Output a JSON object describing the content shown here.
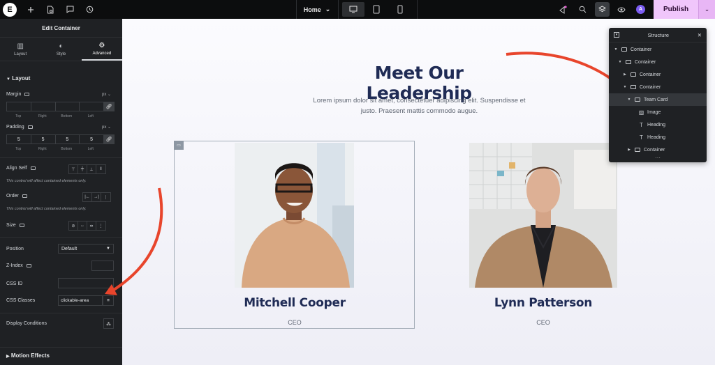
{
  "topbar": {
    "page_name": "Home",
    "publish_label": "Publish",
    "icons": [
      "elementor-logo",
      "add-icon",
      "page-settings-icon",
      "comments-icon",
      "history-icon",
      "desktop-icon",
      "tablet-icon",
      "mobile-icon",
      "notifications-icon",
      "search-icon",
      "structure-icon",
      "preview-icon",
      "account-icon",
      "chevron-down-icon"
    ],
    "account_initial": "A"
  },
  "panel": {
    "title": "Edit Container",
    "tabs": [
      {
        "label": "Layout",
        "icon": "layout-icon"
      },
      {
        "label": "Style",
        "icon": "style-icon"
      },
      {
        "label": "Advanced",
        "icon": "gear-icon",
        "active": true
      }
    ],
    "section_layout": "Layout",
    "margin": {
      "label": "Margin",
      "unit": "px",
      "values": [
        "",
        "",
        "",
        ""
      ],
      "sides": [
        "Top",
        "Right",
        "Bottom",
        "Left"
      ]
    },
    "padding": {
      "label": "Padding",
      "unit": "px",
      "values": [
        "5",
        "5",
        "5",
        "5"
      ],
      "sides": [
        "Top",
        "Right",
        "Bottom",
        "Left"
      ]
    },
    "align_self": {
      "label": "Align Self",
      "note": "This control will affect contained elements only."
    },
    "order": {
      "label": "Order",
      "note": "This control will affect contained elements only."
    },
    "size": {
      "label": "Size"
    },
    "position": {
      "label": "Position",
      "value": "Default"
    },
    "z_index": {
      "label": "Z-Index",
      "value": ""
    },
    "css_id": {
      "label": "CSS ID",
      "value": ""
    },
    "css_classes": {
      "label": "CSS Classes",
      "value": "clickable-area"
    },
    "display_conditions": {
      "label": "Display Conditions"
    },
    "motion_effects": "Motion Effects"
  },
  "canvas": {
    "title": "Meet Our Leadership",
    "text_line1": "Lorem ipsum dolor sit amet, consectetuer adipiscing elit. Suspendisse et",
    "text_line2": "justo. Praesent mattis commodo augue.",
    "members": [
      {
        "name": "Mitchell Cooper",
        "role": "CEO"
      },
      {
        "name": "Lynn Patterson",
        "role": "CEO"
      }
    ]
  },
  "structure": {
    "title": "Structure",
    "items": [
      {
        "label": "Container",
        "type": "container",
        "depth": 0,
        "expanded": true
      },
      {
        "label": "Container",
        "type": "container",
        "depth": 1,
        "expanded": true
      },
      {
        "label": "Container",
        "type": "container",
        "depth": 2,
        "expanded": false
      },
      {
        "label": "Container",
        "type": "container",
        "depth": 2,
        "expanded": true
      },
      {
        "label": "Team Card",
        "type": "container",
        "depth": 3,
        "expanded": true,
        "selected": true
      },
      {
        "label": "Image",
        "type": "image",
        "depth": 4
      },
      {
        "label": "Heading",
        "type": "heading",
        "depth": 4
      },
      {
        "label": "Heading",
        "type": "heading",
        "depth": 4
      },
      {
        "label": "Container",
        "type": "container",
        "depth": 3,
        "expanded": false
      }
    ]
  },
  "colors": {
    "accent_publish": "#f0c6fb",
    "annotation_arrow": "#e8452c",
    "heading": "#1f2b55",
    "panel_bg": "#1f2124"
  }
}
